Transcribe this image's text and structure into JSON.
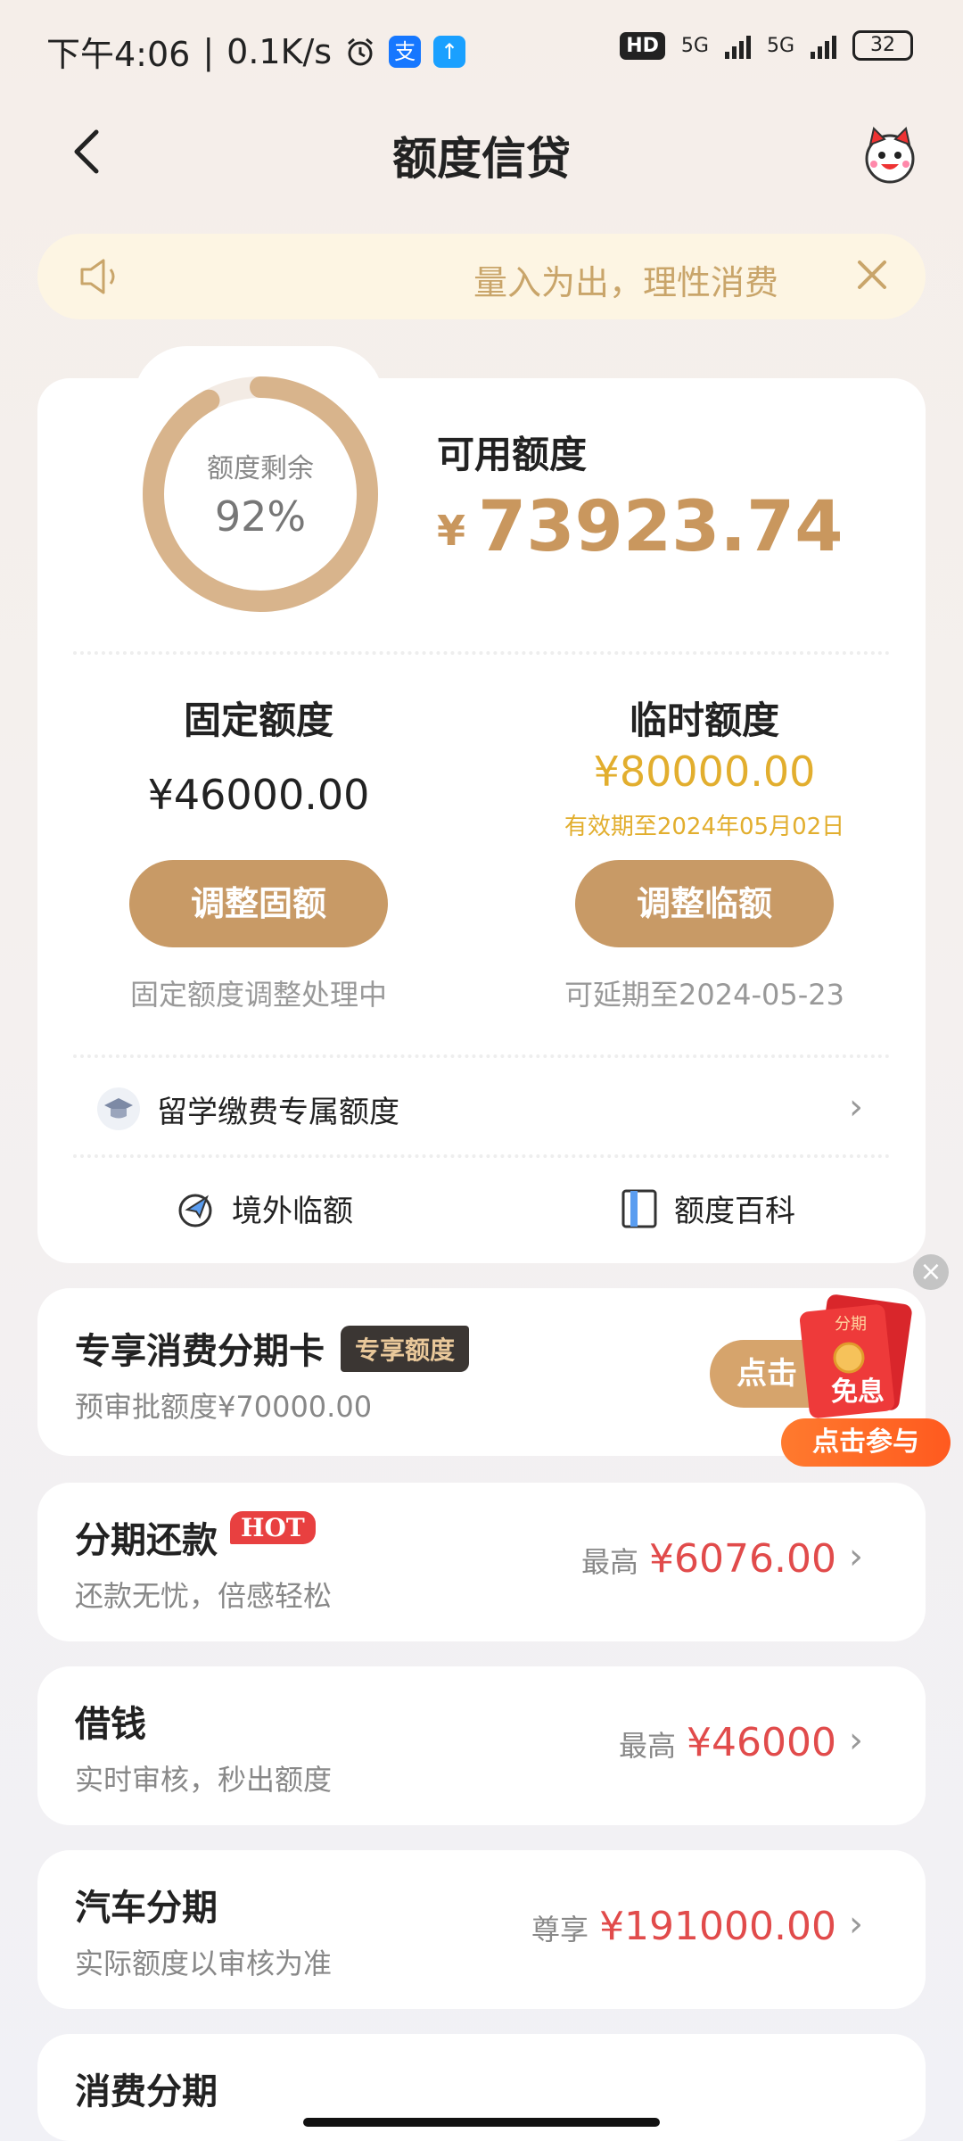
{
  "status_bar": {
    "time": "下午4:06",
    "speed": "0.1K/s",
    "hd": "HD",
    "net1": "5G",
    "net2": "5G",
    "battery": "32"
  },
  "header": {
    "title": "额度信贷"
  },
  "notice": {
    "text": "量入为出，理性消费"
  },
  "credit": {
    "ring_label": "额度剩余",
    "ring_percent_text": "92%",
    "ring_percent": 0.92,
    "available_label": "可用额度",
    "currency": "¥",
    "available_amount": "73923.74",
    "fixed": {
      "label": "固定额度",
      "amount": "¥46000.00",
      "button": "调整固额",
      "note": "固定额度调整处理中"
    },
    "temporary": {
      "label": "临时额度",
      "amount": "¥80000.00",
      "expiry": "有效期至2024年05月02日",
      "button": "调整临额",
      "note": "可延期至2024-05-23"
    },
    "study_abroad": "留学缴费专属额度",
    "overseas": "境外临额",
    "encyclopedia": "额度百科"
  },
  "installment_card": {
    "title": "专享消费分期卡",
    "tag": "专享额度",
    "subtitle": "预审批额度¥70000.00",
    "button": "点击"
  },
  "promo": {
    "envelope_top": "分期",
    "envelope_text": "免息",
    "join": "点击参与"
  },
  "products": [
    {
      "title": "分期还款",
      "badge": "HOT",
      "subtitle": "还款无忧，倍感轻松",
      "prefix": "最高",
      "value": "¥6076.00"
    },
    {
      "title": "借钱",
      "subtitle": "实时审核，秒出额度",
      "prefix": "最高",
      "value": "¥46000"
    },
    {
      "title": "汽车分期",
      "subtitle": "实际额度以审核为准",
      "prefix": "尊享",
      "value": "¥191000.00"
    },
    {
      "title": "消费分期"
    }
  ],
  "colors": {
    "gold": "#c9975e",
    "button_gold": "#c89a66",
    "temp_yellow": "#e2ae2e",
    "price_red": "#e14b4b"
  }
}
